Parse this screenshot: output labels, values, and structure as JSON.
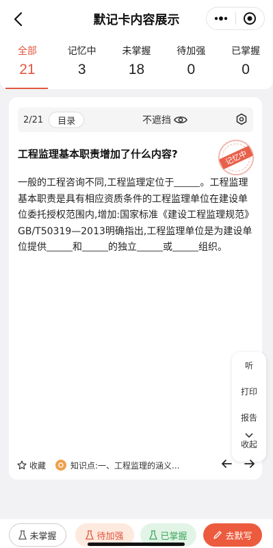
{
  "header": {
    "title": "默记卡内容展示"
  },
  "tabs": [
    {
      "label": "全部",
      "count": "21"
    },
    {
      "label": "记忆中",
      "count": "3"
    },
    {
      "label": "未掌握",
      "count": "18"
    },
    {
      "label": "待加强",
      "count": "0"
    },
    {
      "label": "已掌握",
      "count": "0"
    }
  ],
  "card": {
    "pager": "2/21",
    "directory": "目录",
    "reveal": "不遮挡",
    "stamp": "记忆中",
    "question": "工程监理基本职责增加了什么内容?",
    "content": {
      "p1": "一般的工程咨询不同,工程监理定位于",
      "p2": "。工程监理基本职责是具有相应资质条件的工程监理单位在建设单位委托授权范围内,增加:国家标准《建设工程监理规范》GB/T50319—2013明确指出,工程监理单位是为建设单位提供",
      "p3": "和",
      "p4": "的独立",
      "p5": "或",
      "p6": "组织。"
    },
    "side": {
      "listen": "听",
      "print": "打印",
      "report": "报告",
      "collapse": "收起"
    },
    "footer": {
      "favorite": "收藏",
      "knowledge": "知识点:一、工程监理的涵义..."
    }
  },
  "bottom": {
    "not_mastered": "未掌握",
    "to_improve": "待加强",
    "mastered": "已掌握",
    "dictate": "去默写"
  },
  "colors": {
    "accent": "#e2553e",
    "green": "#3aa55a"
  }
}
